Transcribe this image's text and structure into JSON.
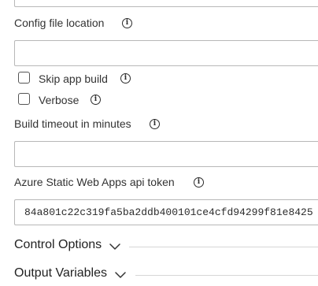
{
  "fields": {
    "top_input": {
      "value": ""
    },
    "config_file_location": {
      "label": "Config file location",
      "value": ""
    },
    "skip_app_build": {
      "label": "Skip app build",
      "checked": false
    },
    "verbose": {
      "label": "Verbose",
      "checked": false
    },
    "build_timeout": {
      "label": "Build timeout in minutes",
      "value": ""
    },
    "api_token": {
      "label": "Azure Static Web Apps api token",
      "value": "84a801c22c319fa5ba2ddb400101ce4cfd94299f81e8425"
    }
  },
  "sections": {
    "control_options": {
      "label": "Control Options"
    },
    "output_variables": {
      "label": "Output Variables"
    }
  },
  "icons": {
    "info": "i"
  }
}
